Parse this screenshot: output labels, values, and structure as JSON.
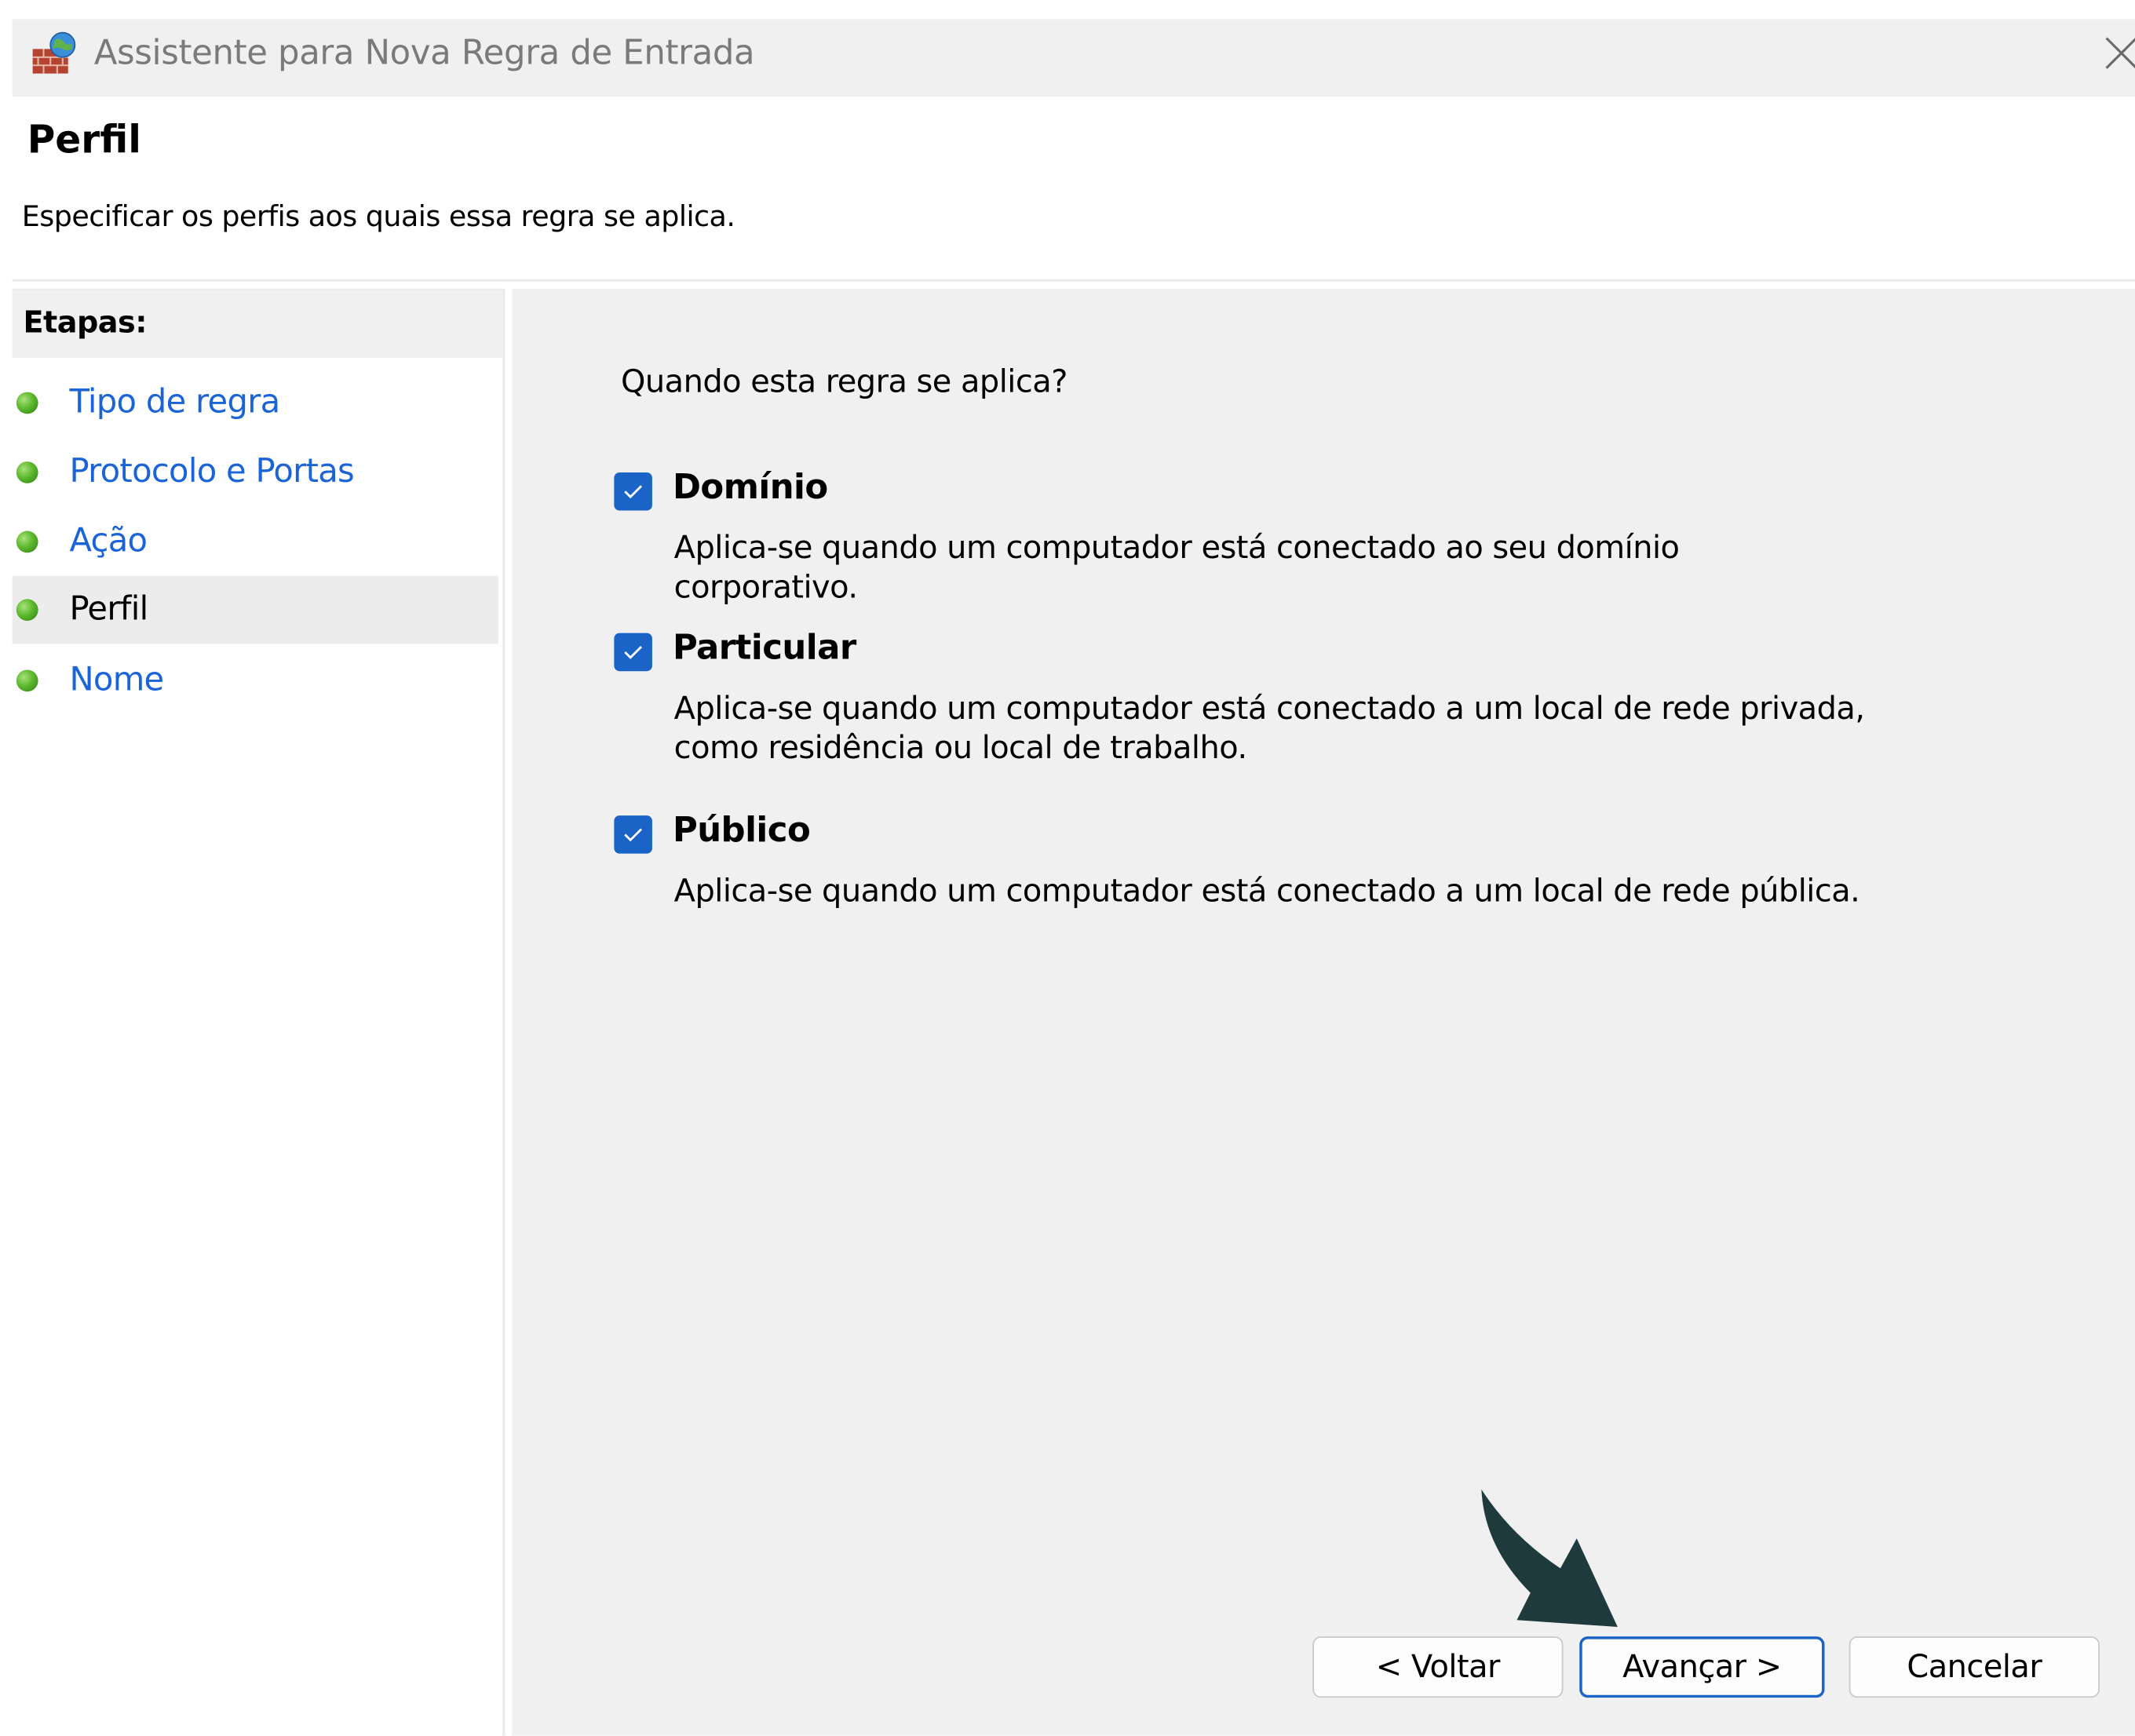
{
  "window": {
    "title": "Assistente para Nova Regra de Entrada"
  },
  "header": {
    "title": "Perfil",
    "subtitle": "Especificar os perfis aos quais essa regra se aplica."
  },
  "steps": {
    "heading": "Etapas:",
    "items": [
      {
        "label": "Tipo de regra",
        "current": false
      },
      {
        "label": "Protocolo e Portas",
        "current": false
      },
      {
        "label": "Ação",
        "current": false
      },
      {
        "label": "Perfil",
        "current": true
      },
      {
        "label": "Nome",
        "current": false
      }
    ]
  },
  "content": {
    "question": "Quando esta regra se aplica?",
    "options": [
      {
        "label": "Domínio",
        "checked": true,
        "description": "Aplica-se quando um computador está conectado ao seu domínio corporativo."
      },
      {
        "label": "Particular",
        "checked": true,
        "description": "Aplica-se quando um computador está conectado a um local de rede privada, como residência ou local de trabalho."
      },
      {
        "label": "Público",
        "checked": true,
        "description": "Aplica-se quando um computador está conectado a um local de rede pública."
      }
    ]
  },
  "buttons": {
    "back": "< Voltar",
    "next": "Avançar >",
    "cancel": "Cancelar"
  },
  "icons": {
    "app": "firewall-globe-icon",
    "close": "close-icon",
    "checkbox": "checkmark-icon",
    "step_bullet": "green-dot-icon",
    "annotation": "curved-arrow-icon"
  },
  "colors": {
    "link": "#1a64d8",
    "checkbox": "#1a64c8",
    "panel_bg": "#f0f0f0",
    "arrow": "#1f3a3d"
  }
}
